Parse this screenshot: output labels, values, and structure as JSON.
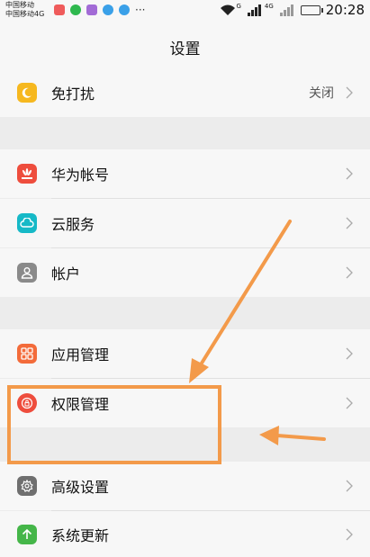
{
  "status_bar": {
    "carrier_line1": "中国移动",
    "carrier_line2": "中国移动4G",
    "more": "···",
    "network_label_1": "G",
    "network_label_2": "4G",
    "time": "20:28"
  },
  "header": {
    "title": "设置"
  },
  "rows": [
    {
      "label": "免打扰",
      "value": "关闭"
    },
    {
      "label": "华为帐号"
    },
    {
      "label": "云服务"
    },
    {
      "label": "帐户"
    },
    {
      "label": "应用管理"
    },
    {
      "label": "权限管理"
    },
    {
      "label": "高级设置"
    },
    {
      "label": "系统更新"
    }
  ],
  "icons": {
    "dnd": "moon-icon",
    "huawei_account": "huawei-logo-icon",
    "cloud": "cloud-icon",
    "account": "person-icon",
    "app_manage": "apps-grid-icon",
    "permission": "lock-shield-icon",
    "advanced": "gear-icon",
    "update": "arrow-up-icon"
  },
  "colors": {
    "annotation": "#f39a4a",
    "dnd": "#f6b81f",
    "huawei": "#ee4d3d",
    "cloud": "#16b9c7",
    "account": "#8a8a8a",
    "app_manage": "#f36b3a",
    "permission": "#ee4d3d",
    "advanced": "#6f6f6f",
    "update": "#45b649"
  }
}
